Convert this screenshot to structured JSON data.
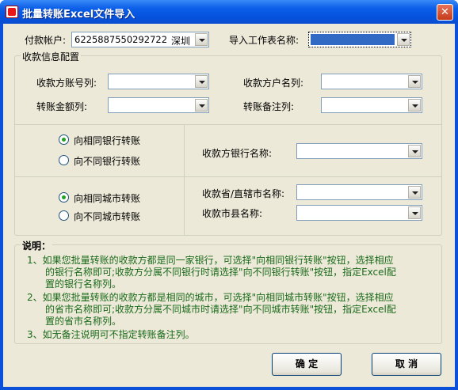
{
  "window": {
    "title": "批量转账Excel文件导入",
    "close": "✕"
  },
  "header": {
    "account_label": "付款帐户:",
    "account_number": "6225887550292722",
    "account_city": "深圳",
    "sheet_label": "导入工作表名称:",
    "sheet_value": ""
  },
  "config": {
    "group_title": "收款信息配置",
    "payee_account_label": "收款方账号列:",
    "payee_name_label": "收款方户名列:",
    "amount_label": "转账金额列:",
    "remark_label": "转账备注列:",
    "same_bank_label": "向相同银行转账",
    "diff_bank_label": "向不同银行转账",
    "bank_name_label": "收款方银行名称:",
    "same_city_label": "向相同城市转账",
    "diff_city_label": "向不同城市转账",
    "province_label": "收款省/直辖市名称:",
    "city_label": "收款市县名称:"
  },
  "notes": {
    "title": "说明：",
    "n1_l1": "1、如果您批量转账的收款方都是同一家银行，可选择\"向相同银行转账\"按钮，选择相应",
    "n1_l2": "的银行名称即可;收款方分属不同银行时请选择\"向不同银行转账\"按钮，指定Excel配",
    "n1_l3": "置的银行名称列。",
    "n2_l1": "2、如果您批量转账的收款方都是相同的城市，可选择\"向相同城市转账\"按钮，选择相应",
    "n2_l2": "的省市名称即可;收款方分属不同城市时请选择\"向不同城市转账\"按钮，指定Excel配",
    "n2_l3": "置的省市名称列。",
    "n3": "3、如无备注说明可不指定转账备注列。"
  },
  "buttons": {
    "ok": "确 定",
    "cancel": "取 消"
  },
  "state": {
    "same_bank_selected": true,
    "same_city_selected": true
  }
}
